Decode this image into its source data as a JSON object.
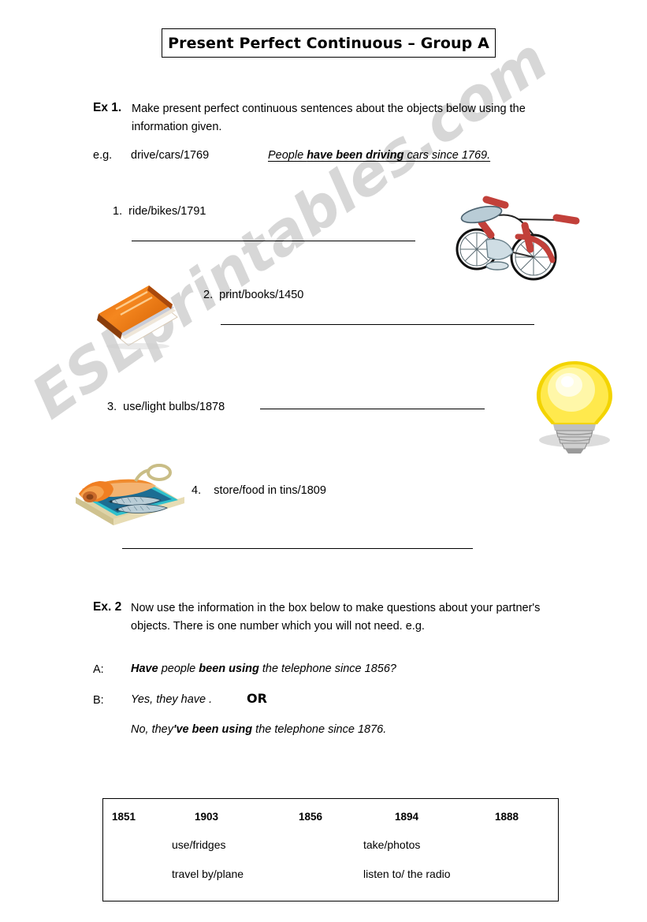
{
  "watermark": {
    "text": "ESLprintables.com"
  },
  "title": {
    "text": "Present Perfect Continuous – Group A"
  },
  "ex1": {
    "label": "Ex 1.",
    "instructions": "Make present perfect continuous sentences about the objects below using the information given.",
    "example": {
      "label": "e.g.",
      "prompt": "drive/cars/1769",
      "answer_pre": "People ",
      "answer_bold": "have been driving",
      "answer_post": " cars since 1769."
    },
    "items": [
      {
        "number": "1.",
        "prompt": "ride/bikes/1791",
        "image": "tricycle-illustration"
      },
      {
        "number": "2.",
        "prompt": "print/books/1450",
        "image": "book-illustration"
      },
      {
        "number": "3.",
        "prompt": "use/light bulbs/1878",
        "image": "lightbulb-illustration"
      },
      {
        "number": "4.",
        "prompt": "store/food in tins/1809",
        "image": "sardine-tin-illustration"
      }
    ]
  },
  "ex2": {
    "label": "Ex. 2",
    "instructions": "Now use the information in the box below to make questions about your partner's objects. There is one number which you will not need.  e.g.",
    "dialogue": {
      "a_label": "A:",
      "a_pre": "",
      "a_bold1": "Have",
      "a_mid": " people ",
      "a_bold2": "been using",
      "a_post": " the telephone since 1856?",
      "b_label": "B:",
      "b_answer_yes": "Yes, they have .",
      "or": "OR",
      "b_no_pre": "No, they",
      "b_no_bold": "'ve been using",
      "b_no_post": " the telephone since 1876."
    },
    "wordbox": {
      "years": [
        "1851",
        "1903",
        "1856",
        "1894",
        "1888"
      ],
      "activities_col1": [
        "use/fridges",
        "travel by/plane"
      ],
      "activities_col2": [
        "take/photos",
        "listen to/ the radio"
      ]
    }
  },
  "colors": {
    "ink": "#000000",
    "watermark": "#c9c9c9",
    "book_cover": "#f07c1a",
    "bulb_glow": "#ffe94d",
    "bike_red": "#d6453f",
    "tin_teal": "#3fbfc9"
  }
}
